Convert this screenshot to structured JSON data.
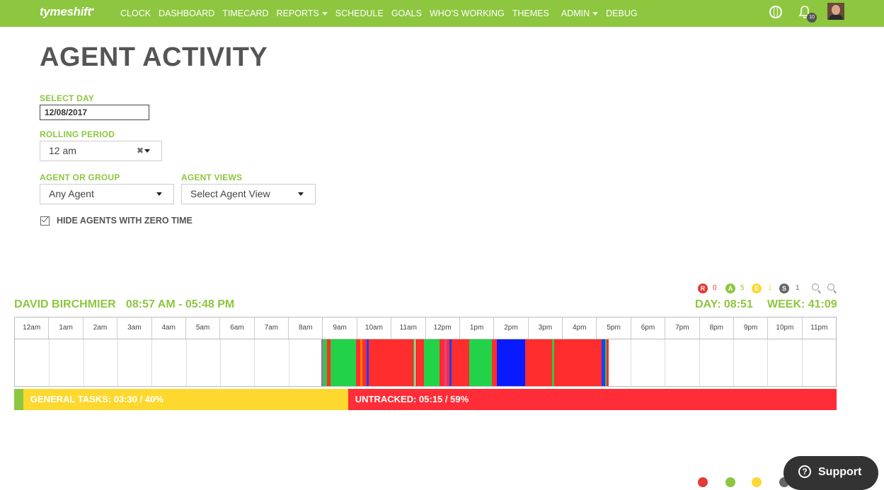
{
  "nav": {
    "logo": "tymeshift",
    "items": [
      {
        "label": "CLOCK",
        "dropdown": false
      },
      {
        "label": "DASHBOARD",
        "dropdown": false
      },
      {
        "label": "TIMECARD",
        "dropdown": false
      },
      {
        "label": "REPORTS",
        "dropdown": true
      },
      {
        "label": "SCHEDULE",
        "dropdown": false
      },
      {
        "label": "GOALS",
        "dropdown": false
      },
      {
        "label": "WHO'S WORKING",
        "dropdown": false
      },
      {
        "label": "THEMES",
        "dropdown": false
      },
      {
        "label": "ADMIN",
        "dropdown": true
      },
      {
        "label": "DEBUG",
        "dropdown": false
      }
    ],
    "notification_count": "10",
    "icons": [
      "globe-icon",
      "bell-icon",
      "avatar"
    ]
  },
  "page": {
    "title": "AGENT ACTIVITY"
  },
  "filters": {
    "select_day_label": "SELECT DAY",
    "select_day_value": "12/08/2017",
    "rolling_period_label": "ROLLING PERIOD",
    "rolling_period_value": "12 am",
    "agent_label": "AGENT OR GROUP",
    "agent_value": "Any Agent",
    "views_label": "AGENT VIEWS",
    "views_value": "Select Agent View",
    "hide_zero_label": "HIDE AGENTS WITH ZERO TIME",
    "hide_zero_checked": true
  },
  "agent": {
    "name": "DAVID BIRCHMIER",
    "range": "08:57 AM - 05:48 PM",
    "day_total": "DAY: 08:51",
    "week_total": "WEEK: 41:09",
    "badges": [
      {
        "letter": "R",
        "count": "0",
        "color": "#e53935"
      },
      {
        "letter": "A",
        "count": "5",
        "color": "#8dc63f"
      },
      {
        "letter": "E",
        "count": "1",
        "color": "#fdd835"
      },
      {
        "letter": "S",
        "count": "1",
        "color": "#666666"
      }
    ],
    "hours": [
      "12am",
      "1am",
      "2am",
      "3am",
      "4am",
      "5am",
      "6am",
      "7am",
      "8am",
      "9am",
      "10am",
      "11am",
      "12pm",
      "1pm",
      "2pm",
      "3pm",
      "4pm",
      "5pm",
      "6pm",
      "7pm",
      "8pm",
      "9pm",
      "10pm",
      "11pm"
    ],
    "activity": [
      {
        "start": 8.95,
        "end": 9.0,
        "color": "#b05cc8"
      },
      {
        "start": 9.0,
        "end": 9.13,
        "color": "#2ecc40"
      },
      {
        "start": 9.13,
        "end": 9.22,
        "color": "#ff2d2d"
      },
      {
        "start": 9.22,
        "end": 9.28,
        "color": "#2ecc40"
      },
      {
        "start": 9.28,
        "end": 9.98,
        "color": "#22d34a"
      },
      {
        "start": 9.98,
        "end": 10.1,
        "color": "#ff2d2d"
      },
      {
        "start": 10.1,
        "end": 10.15,
        "color": "#ff7f00"
      },
      {
        "start": 10.15,
        "end": 10.28,
        "color": "#ff2d2d"
      },
      {
        "start": 10.28,
        "end": 10.35,
        "color": "#1f3dff"
      },
      {
        "start": 10.35,
        "end": 11.65,
        "color": "#ff2d2d"
      },
      {
        "start": 11.65,
        "end": 11.7,
        "color": "#2ecc40"
      },
      {
        "start": 11.7,
        "end": 11.95,
        "color": "#ff2d2d"
      },
      {
        "start": 11.95,
        "end": 12.42,
        "color": "#22d34a"
      },
      {
        "start": 12.42,
        "end": 12.55,
        "color": "#ff2d2d"
      },
      {
        "start": 12.55,
        "end": 12.62,
        "color": "#e040a0"
      },
      {
        "start": 12.62,
        "end": 12.7,
        "color": "#ff2d2d"
      },
      {
        "start": 12.7,
        "end": 12.77,
        "color": "#1f3dff"
      },
      {
        "start": 12.77,
        "end": 13.28,
        "color": "#ff2d2d"
      },
      {
        "start": 13.28,
        "end": 13.95,
        "color": "#22d34a"
      },
      {
        "start": 13.95,
        "end": 14.08,
        "color": "#ff2d2d"
      },
      {
        "start": 14.08,
        "end": 14.92,
        "color": "#0a1aff"
      },
      {
        "start": 14.92,
        "end": 15.7,
        "color": "#ff2d2d"
      },
      {
        "start": 15.7,
        "end": 15.77,
        "color": "#2ecc40"
      },
      {
        "start": 15.77,
        "end": 17.15,
        "color": "#ff2d2d"
      },
      {
        "start": 17.15,
        "end": 17.25,
        "color": "#1f3dff"
      },
      {
        "start": 17.25,
        "end": 17.3,
        "color": "#2ecc40"
      },
      {
        "start": 17.3,
        "end": 17.35,
        "color": "#ff2d2d"
      }
    ],
    "summary": [
      {
        "label": "",
        "fraction": 0.011,
        "color": "#8dc63f"
      },
      {
        "label": "GENERAL TASKS:  03:30 / 40%",
        "fraction": 0.395,
        "color": "#fdd82f"
      },
      {
        "label": "UNTRACKED:  05:15 / 59%",
        "fraction": 0.594,
        "color": "#ff2d37"
      }
    ]
  },
  "next_agent": {
    "badge_colors": [
      "#e53935",
      "#8dc63f",
      "#fdd835",
      "#666666"
    ]
  },
  "support": {
    "label": "Support"
  }
}
